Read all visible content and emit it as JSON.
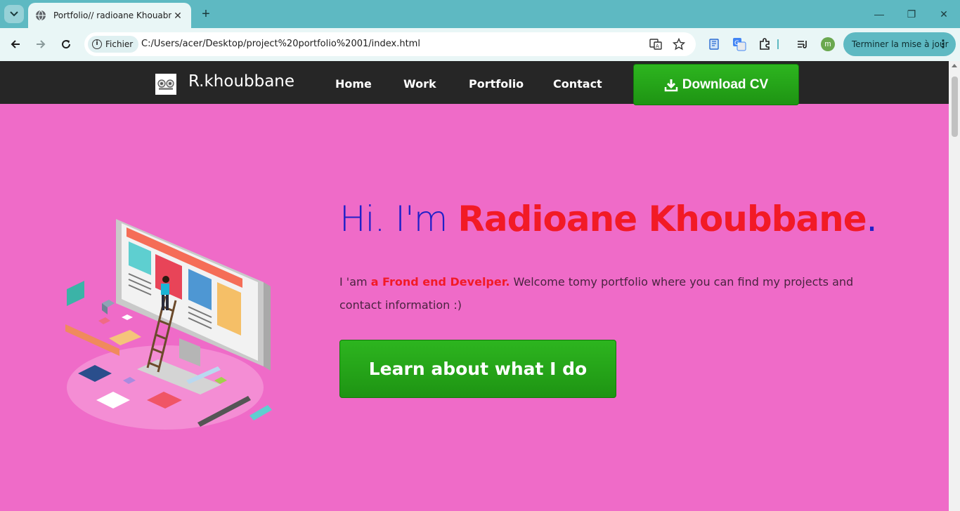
{
  "browser": {
    "tab_title": "Portfolio// radioane Khouabne",
    "tab_close": "✕",
    "new_tab": "+",
    "site_chip": "Fichier",
    "url": "C:/Users/acer/Desktop/project%20portfolio%2001/index.html",
    "profile_initial": "m",
    "update_label": "Terminer la mise à jour",
    "window_controls": {
      "minimize": "—",
      "restore": "❐",
      "close": "✕"
    }
  },
  "site": {
    "brand": "R.khoubbane",
    "nav": {
      "home": "Home",
      "work": "Work",
      "portfolio": "Portfolio",
      "contact": "Contact"
    },
    "cv_button": "Download CV",
    "hero": {
      "greeting": "Hi. I'm ",
      "name": "Radioane Khoubbane",
      "dot": ".",
      "text_prefix": "I 'am ",
      "role": "a Frond end Develper.",
      "text_rest": " Welcome tomy portfolio where you can find my projects and contact information :)",
      "cta": "Learn about what I do"
    }
  },
  "colors": {
    "page_bg": "#ef6bc8",
    "nav_bg": "#262626",
    "accent_red": "#f21a26",
    "accent_blue": "#2020c8",
    "button_green": "#2db51f",
    "chrome_teal": "#5eb9c2"
  },
  "icons": {
    "tab_menu": "chevron-down-icon",
    "favicon": "globe-icon",
    "back": "back-arrow-icon",
    "forward": "forward-arrow-icon",
    "reload": "reload-icon",
    "translate": "translate-icon",
    "bookmark": "star-icon",
    "download": "download-icon"
  }
}
